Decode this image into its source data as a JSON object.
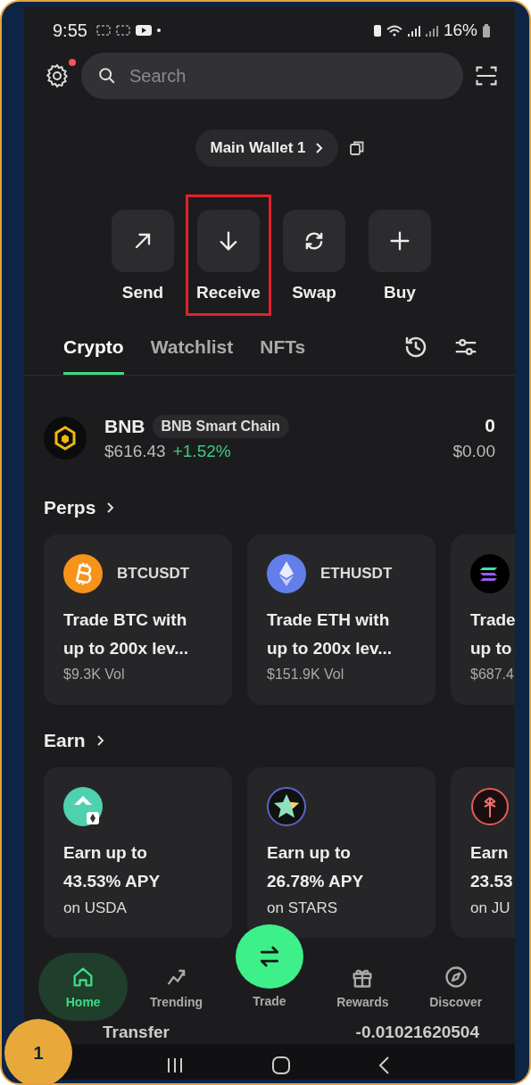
{
  "status_bar": {
    "time": "9:55",
    "battery": "16%"
  },
  "settings": {
    "notification": true
  },
  "search": {
    "placeholder": "Search"
  },
  "wallet": {
    "name": "Main Wallet 1"
  },
  "actions": [
    {
      "label": "Send",
      "kind": "send",
      "highlighted": false
    },
    {
      "label": "Receive",
      "kind": "receive",
      "highlighted": true
    },
    {
      "label": "Swap",
      "kind": "swap",
      "highlighted": false
    },
    {
      "label": "Buy",
      "kind": "buy",
      "highlighted": false
    }
  ],
  "tabs": [
    {
      "label": "Crypto",
      "selected": true
    },
    {
      "label": "Watchlist",
      "selected": false
    },
    {
      "label": "NFTs",
      "selected": false
    }
  ],
  "tokens": [
    {
      "symbol": "BNB",
      "network": "BNB Smart Chain",
      "price": "$616.43",
      "change": "+1.52%",
      "balance": "0",
      "value": "$0.00"
    }
  ],
  "perps": {
    "title": "Perps",
    "cards": [
      {
        "kind": "btc",
        "pair": "BTCUSDT",
        "line_1": "Trade BTC with",
        "line_2": "up to 200x lev...",
        "volume": "$9.3K Vol"
      },
      {
        "kind": "eth",
        "pair": "ETHUSDT",
        "line_1": "Trade ETH with",
        "line_2": "up to 200x lev...",
        "volume": "$151.9K Vol"
      },
      {
        "kind": "sol",
        "line_1": "Trade",
        "line_2": "up to",
        "volume": "$687.4"
      }
    ]
  },
  "earn": {
    "title": "Earn",
    "cards": [
      {
        "kind": "usda",
        "line_1": "Earn up to",
        "line_2": "43.53% APY",
        "line_3": "on USDA"
      },
      {
        "kind": "stars",
        "line_1": "Earn up to",
        "line_2": "26.78% APY",
        "line_3": "on STARS"
      },
      {
        "kind": "palm",
        "line_1": "Earn",
        "line_2": "23.53",
        "line_3": "on JU"
      }
    ]
  },
  "bottom_nav": [
    {
      "label": "Home",
      "kind": "home",
      "selected": true
    },
    {
      "label": "Trending",
      "kind": "trending",
      "selected": false
    },
    {
      "label": "Trade",
      "kind": "trade",
      "selected": false
    },
    {
      "label": "Rewards",
      "kind": "rewards",
      "selected": false
    },
    {
      "label": "Discover",
      "kind": "discover",
      "selected": false
    }
  ],
  "peek_row": {
    "label": "Transfer",
    "amount": "-0.01021620504"
  },
  "step_badge": "1"
}
